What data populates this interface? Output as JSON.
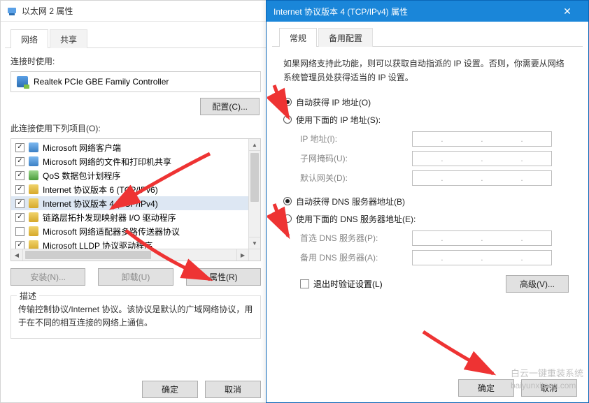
{
  "left": {
    "title": "以太网 2 属性",
    "tabs": {
      "network": "网络",
      "share": "共享"
    },
    "connect_using_label": "连接时使用:",
    "adapter_name": "Realtek PCIe GBE Family Controller",
    "configure_btn": "配置(C)...",
    "items_label": "此连接使用下列项目(O):",
    "items": [
      {
        "checked": true,
        "label": "Microsoft 网络客户端"
      },
      {
        "checked": true,
        "label": "Microsoft 网络的文件和打印机共享"
      },
      {
        "checked": true,
        "label": "QoS 数据包计划程序"
      },
      {
        "checked": true,
        "label": "Internet 协议版本 6 (TCP/IPv6)"
      },
      {
        "checked": true,
        "label": "Internet 协议版本 4 (TCP/IPv4)",
        "selected": true
      },
      {
        "checked": true,
        "label": "链路层拓扑发现映射器 I/O 驱动程序"
      },
      {
        "checked": false,
        "label": "Microsoft 网络适配器多路传送器协议"
      },
      {
        "checked": true,
        "label": "Microsoft LLDP 协议驱动程序"
      }
    ],
    "install_btn": "安装(N)...",
    "uninstall_btn": "卸载(U)",
    "properties_btn": "属性(R)",
    "group_legend": "描述",
    "description": "传输控制协议/Internet 协议。该协议是默认的广域网络协议，用于在不同的相互连接的网络上通信。",
    "ok_btn": "确定",
    "cancel_btn": "取消"
  },
  "right": {
    "title": "Internet 协议版本 4 (TCP/IPv4) 属性",
    "tabs": {
      "general": "常规",
      "alt": "备用配置"
    },
    "intro": "如果网络支持此功能，则可以获取自动指派的 IP 设置。否则，你需要从网络系统管理员处获得适当的 IP 设置。",
    "radio_auto_ip": "自动获得 IP 地址(O)",
    "radio_manual_ip": "使用下面的 IP 地址(S):",
    "ip_label": "IP 地址(I):",
    "mask_label": "子网掩码(U):",
    "gateway_label": "默认网关(D):",
    "radio_auto_dns": "自动获得 DNS 服务器地址(B)",
    "radio_manual_dns": "使用下面的 DNS 服务器地址(E):",
    "dns1_label": "首选 DNS 服务器(P):",
    "dns2_label": "备用 DNS 服务器(A):",
    "validate_label": "退出时验证设置(L)",
    "advanced_btn": "高级(V)...",
    "ok_btn": "确定",
    "cancel_btn": "取消"
  },
  "watermark": {
    "cn": "白云一键重装系统",
    "en": "baiyunxitong.com"
  }
}
